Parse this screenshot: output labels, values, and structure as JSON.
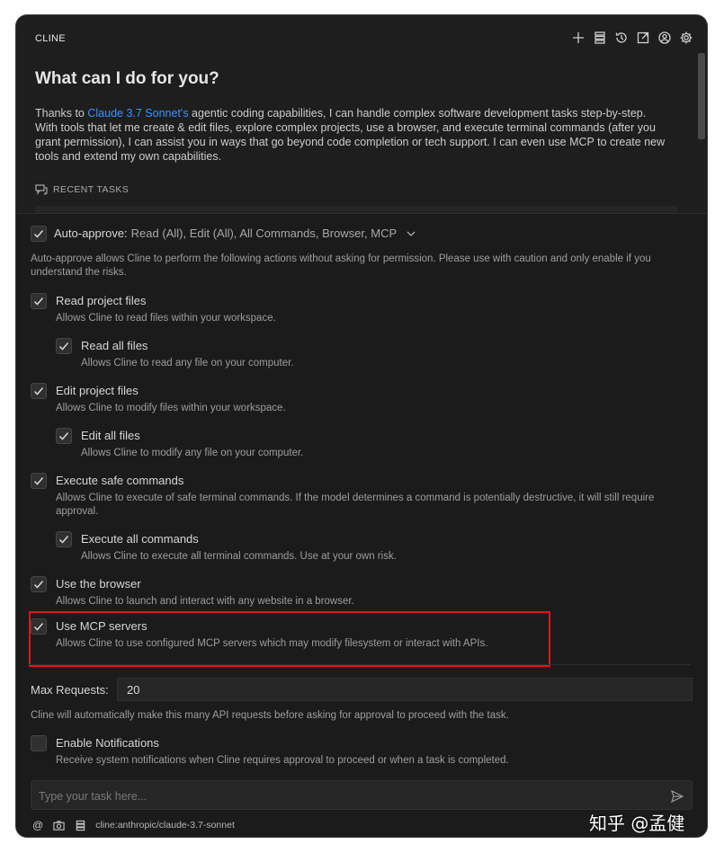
{
  "app_title": "CLINE",
  "hero_title": "What can I do for you?",
  "intro": {
    "prefix": "Thanks to ",
    "link": "Claude 3.7 Sonnet's",
    "suffix": " agentic coding capabilities, I can handle complex software development tasks step-by-step. With tools that let me create & edit files, explore complex projects, use a browser, and execute terminal commands (after you grant permission), I can assist you in ways that go beyond code completion or tech support. I can even use MCP to create new tools and extend my own capabilities."
  },
  "recent_tasks_label": "RECENT TASKS",
  "auto_approve": {
    "label": "Auto-approve:",
    "values": "Read (All), Edit (All), All Commands, Browser, MCP",
    "checked": true,
    "description": "Auto-approve allows Cline to perform the following actions without asking for permission. Please use with caution and only enable if you understand the risks."
  },
  "options": [
    {
      "label": "Read project files",
      "desc": "Allows Cline to read files within your workspace.",
      "checked": true
    },
    {
      "label": "Read all files",
      "desc": "Allows Cline to read any file on your computer.",
      "checked": true
    },
    {
      "label": "Edit project files",
      "desc": "Allows Cline to modify files within your workspace.",
      "checked": true
    },
    {
      "label": "Edit all files",
      "desc": "Allows Cline to modify any file on your computer.",
      "checked": true
    },
    {
      "label": "Execute safe commands",
      "desc": "Allows Cline to execute of safe terminal commands. If the model determines a command is potentially destructive, it will still require approval.",
      "checked": true
    },
    {
      "label": "Execute all commands",
      "desc": "Allows Cline to execute all terminal commands. Use at your own risk.",
      "checked": true
    },
    {
      "label": "Use the browser",
      "desc": "Allows Cline to launch and interact with any website in a browser.",
      "checked": true
    },
    {
      "label": "Use MCP servers",
      "desc": "Allows Cline to use configured MCP servers which may modify filesystem or interact with APIs.",
      "checked": true
    }
  ],
  "max_requests": {
    "label": "Max Requests:",
    "value": "20",
    "description": "Cline will automatically make this many API requests before asking for approval to proceed with the task."
  },
  "notifications": {
    "label": "Enable Notifications",
    "desc": "Receive system notifications when Cline requires approval to proceed or when a task is completed.",
    "checked": false
  },
  "task_input": {
    "placeholder": "Type your task here..."
  },
  "footer": {
    "at": "@",
    "model": "cline:anthropic/claude-3.7-sonnet"
  },
  "watermark": "知乎 @孟健",
  "colors": {
    "accent_link": "#3794ff",
    "highlight_border": "#e0151c",
    "background": "#1e1e1e"
  }
}
